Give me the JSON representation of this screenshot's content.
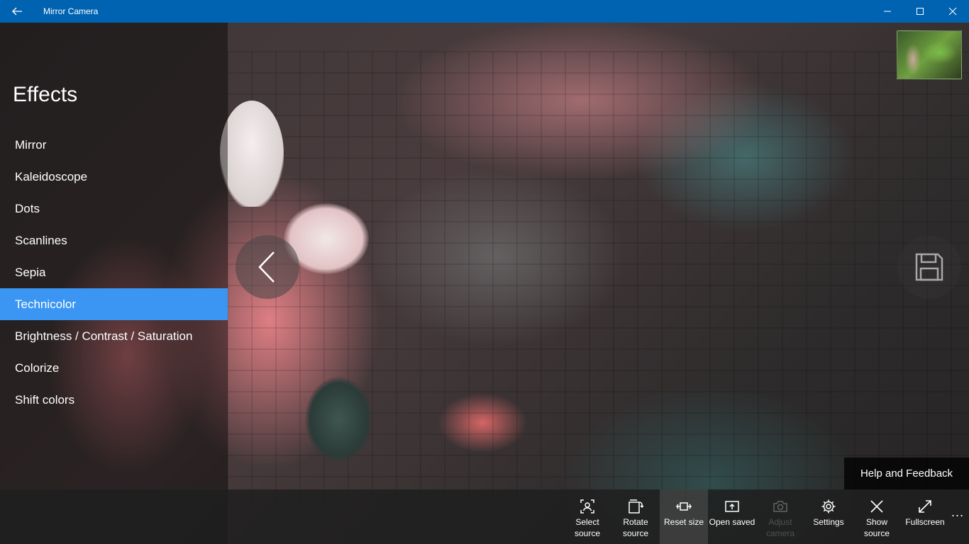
{
  "app": {
    "title": "Mirror Camera"
  },
  "titlebar": {
    "back_icon": "back-arrow-icon",
    "minimize_icon": "minimize-icon",
    "maximize_icon": "maximize-icon",
    "close_icon": "close-icon",
    "color": "#0063b1"
  },
  "effects": {
    "title": "Effects",
    "items": [
      {
        "label": "Mirror"
      },
      {
        "label": "Kaleidoscope"
      },
      {
        "label": "Dots"
      },
      {
        "label": "Scanlines"
      },
      {
        "label": "Sepia"
      },
      {
        "label": "Technicolor",
        "selected": true
      },
      {
        "label": "Brightness / Contrast / Saturation"
      },
      {
        "label": "Colorize"
      },
      {
        "label": "Shift colors"
      }
    ],
    "selected_color": "#3a96f2"
  },
  "help": {
    "label": "Help and Feedback"
  },
  "commands": [
    {
      "label": "Select source",
      "icon": "select-source-icon"
    },
    {
      "label": "Rotate source",
      "icon": "rotate-icon"
    },
    {
      "label": "Reset size",
      "icon": "reset-size-icon"
    },
    {
      "label": "Open saved",
      "icon": "open-saved-icon"
    },
    {
      "label": "Adjust camera",
      "icon": "camera-icon",
      "disabled": true
    },
    {
      "label": "Settings",
      "icon": "gear-icon"
    },
    {
      "label": "Show source",
      "icon": "close-icon"
    },
    {
      "label": "Fullscreen",
      "icon": "fullscreen-icon"
    }
  ],
  "more": {
    "label": "..."
  }
}
